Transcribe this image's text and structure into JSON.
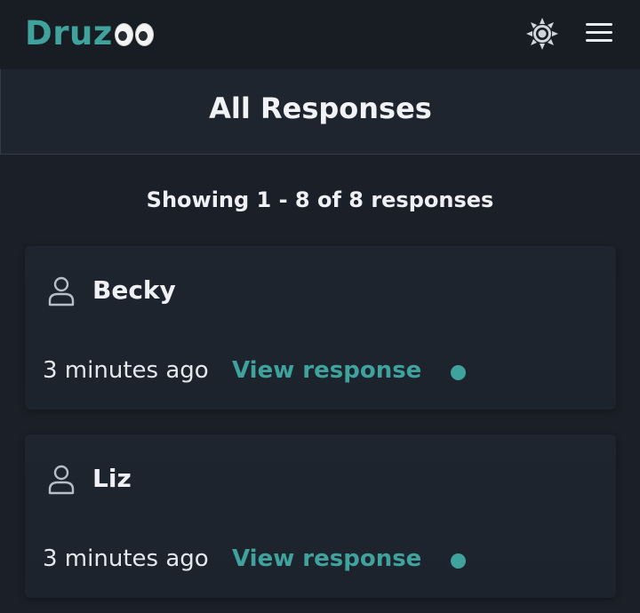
{
  "brand": {
    "name": "Druz",
    "accent_color": "#3fa29c"
  },
  "header": {
    "theme_toggle_icon": "sun-icon",
    "menu_icon": "hamburger-menu-icon"
  },
  "page": {
    "title": "All Responses",
    "count_text": "Showing 1 - 8 of 8 responses"
  },
  "responses": [
    {
      "name": "Becky",
      "time": "3 minutes ago",
      "link_label": "View response",
      "status": "new"
    },
    {
      "name": "Liz",
      "time": "3 minutes ago",
      "link_label": "View response",
      "status": "new"
    }
  ]
}
